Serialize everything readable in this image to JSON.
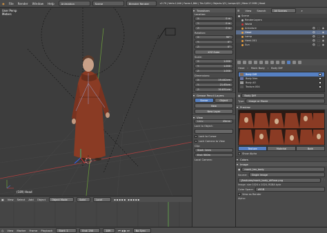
{
  "topbar": {
    "menus": [
      "File",
      "Render",
      "Window",
      "Help"
    ],
    "layout": "Animation",
    "scene": "Scene",
    "engine": "Blender Render",
    "stats": "v2.79 | Verts:2,040 | Faces:1,864 | Tris:3,654 | Objects:1/5 | Lamps:0/2 | Mem:17.99M | Head"
  },
  "viewport": {
    "view_name": "User Persp",
    "units": "Meters",
    "object_label": "(189) Head"
  },
  "viewport_header": {
    "items": [
      "View",
      "Select",
      "Add",
      "Object"
    ],
    "mode": "Object Mode",
    "pivot": "Local",
    "shading": "Solid"
  },
  "timeline_header": {
    "items": [
      "View",
      "Marker",
      "Frame",
      "Playback"
    ],
    "start": "Start: 1",
    "end": "End: 250",
    "current": "189",
    "sync": "No Sync"
  },
  "npanel": {
    "transform_title": "Transform",
    "location_label": "Location:",
    "location": [
      {
        "ax": "X:",
        "v": "0 m"
      },
      {
        "ax": "Y:",
        "v": "0 m"
      },
      {
        "ax": "Z:",
        "v": "0 m"
      }
    ],
    "rotation_label": "Rotation:",
    "rotation": [
      {
        "ax": "X:",
        "v": "90°"
      },
      {
        "ax": "Y:",
        "v": "0°"
      },
      {
        "ax": "Z:",
        "v": "0°"
      }
    ],
    "rotation_mode": "XYZ Euler",
    "scale_label": "Scale:",
    "scale": [
      {
        "ax": "X:",
        "v": "1.000"
      },
      {
        "ax": "Y:",
        "v": "1.000"
      },
      {
        "ax": "Z:",
        "v": "1.000"
      }
    ],
    "dimensions_label": "Dimensions:",
    "dimensions": [
      {
        "ax": "X:",
        "v": "19.442cm"
      },
      {
        "ax": "Y:",
        "v": "21.63cm"
      },
      {
        "ax": "Z:",
        "v": "30.831cm"
      }
    ],
    "grease_title": "Grease Pencil Layers",
    "gp_tabs": [
      "Scene",
      "Object"
    ],
    "gp_new": "New",
    "gp_new_layer": "New Layer",
    "view_title": "View",
    "lens_label": "Lens:",
    "lens_value": "45mm",
    "lock_label": "Lock to Object:",
    "lock_cursor": "Lock to Cursor",
    "lock_camera": "Lock Camera to View",
    "clip_label": "Clip:",
    "clip_start": "Start: 1mm",
    "clip_end": "End: 500m",
    "local_camera": "Local Camera:"
  },
  "outliner": {
    "view": "View",
    "search": "Search",
    "filter": "All Scenes",
    "rows": [
      {
        "label": "Scene",
        "sel": false
      },
      {
        "label": "RenderLayers",
        "sel": false
      },
      {
        "label": "World",
        "sel": false
      },
      {
        "label": "Armature",
        "sel": false
      },
      {
        "label": "Head",
        "sel": true
      },
      {
        "label": "Lamp",
        "sel": false
      },
      {
        "label": "Hemi.001",
        "sel": false
      },
      {
        "label": "Sun",
        "sel": false
      }
    ]
  },
  "properties": {
    "crumbs": [
      "Head",
      "Monk Body",
      "Body Diff"
    ],
    "slots": [
      {
        "label": "Body Diff",
        "sel": true
      },
      {
        "label": "Body Nrm",
        "sel": false
      },
      {
        "label": "Body AO",
        "sel": false
      },
      {
        "label": "Texture.004",
        "sel": false
      }
    ],
    "texture_name": "Body Diff",
    "type_label": "Type:",
    "type_value": "Image or Movie",
    "preview_title": "Preview",
    "preview_modes": [
      "Texture",
      "Material",
      "Both"
    ],
    "show_alpha": "Show Alpha",
    "colors_title": "Colors",
    "image_title": "Image",
    "image_name": "monk_tex_body",
    "source_label": "Source:",
    "source_value": "Single Image",
    "path": "//textures/monk_body_diffuse.png",
    "image_info": "Image: size 1024 x 1024, RGBA byte",
    "color_space_label": "Color Space:",
    "color_space_value": "sRGB",
    "view_as_render": "View as Render",
    "alpha": "Alpha:"
  },
  "colors": {
    "accent": "#5680c2",
    "robe": "#8a3b24",
    "grid_x": "#b04040",
    "grid_y": "#6a9a3c"
  }
}
